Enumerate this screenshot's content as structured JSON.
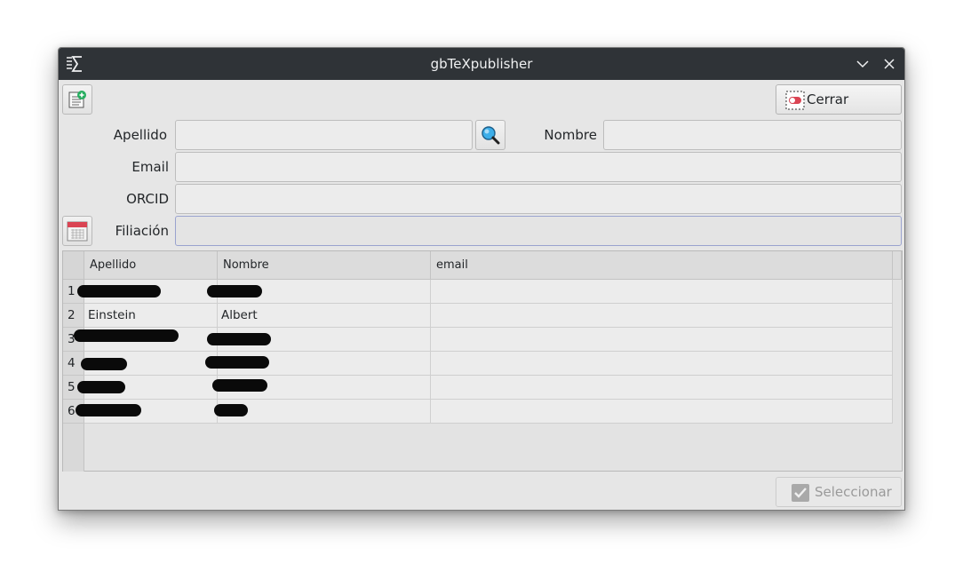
{
  "window": {
    "title": "gbTeXpublisher"
  },
  "toolbar": {
    "close_label": "Cerrar"
  },
  "form": {
    "surname_label": "Apellido",
    "surname_value": "",
    "name_label": "Nombre",
    "name_value": "",
    "email_label": "Email",
    "email_value": "",
    "orcid_label": "ORCID",
    "orcid_value": "",
    "affiliation_label": "Filiación",
    "affiliation_value": ""
  },
  "table": {
    "columns": [
      "Apellido",
      "Nombre",
      "email"
    ],
    "rows": [
      {
        "num": "1",
        "apellido": "",
        "nombre": "",
        "email": "",
        "redacted": true
      },
      {
        "num": "2",
        "apellido": "Einstein",
        "nombre": "Albert",
        "email": "",
        "redacted": false
      },
      {
        "num": "3",
        "apellido": "",
        "nombre": "",
        "email": "",
        "redacted": true
      },
      {
        "num": "4",
        "apellido": "",
        "nombre": "",
        "email": "",
        "redacted": true
      },
      {
        "num": "5",
        "apellido": "",
        "nombre": "",
        "email": "",
        "redacted": true
      },
      {
        "num": "6",
        "apellido": "",
        "nombre": "",
        "email": "",
        "redacted": true
      }
    ]
  },
  "footer": {
    "select_label": "Seleccionar"
  },
  "icons": {
    "app": "sigma-icon",
    "new": "new-document-icon",
    "close_btn": "toggle-switch-icon",
    "search": "magnifier-icon",
    "affiliation": "calendar-icon",
    "select": "checkmark-icon"
  },
  "colors": {
    "titlebar": "#2f3337",
    "accent": "#3daee9",
    "close_red": "#da4453",
    "check_green": "#27ae60"
  }
}
